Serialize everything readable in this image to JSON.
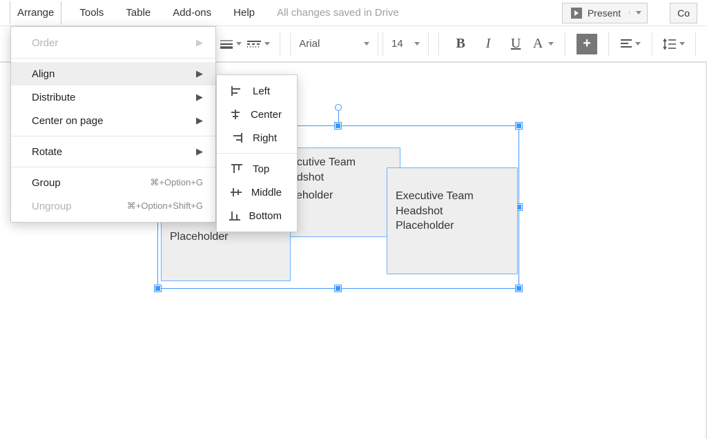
{
  "menubar": {
    "items": [
      "Arrange",
      "Tools",
      "Table",
      "Add-ons",
      "Help"
    ],
    "active_index": 0,
    "save_status": "All changes saved in Drive",
    "present_label": "Present",
    "co_label": "Co"
  },
  "toolbar": {
    "font_name": "Arial",
    "font_size": "14"
  },
  "arrange_menu": {
    "order": "Order",
    "align": "Align",
    "distribute": "Distribute",
    "center_on_page": "Center on page",
    "rotate": "Rotate",
    "group": "Group",
    "group_shortcut": "⌘+Option+G",
    "ungroup": "Ungroup",
    "ungroup_shortcut": "⌘+Option+Shift+G"
  },
  "align_submenu": {
    "left": "Left",
    "center": "Center",
    "right": "Right",
    "top": "Top",
    "middle": "Middle",
    "bottom": "Bottom"
  },
  "canvas": {
    "box1_text": "Placeholder",
    "box2_line1": "ecutive Team",
    "box2_line2": "adshot",
    "box2_line3": "ceholder",
    "box3_line1": "Executive Team",
    "box3_line2": "Headshot",
    "box3_line3": "Placeholder"
  }
}
